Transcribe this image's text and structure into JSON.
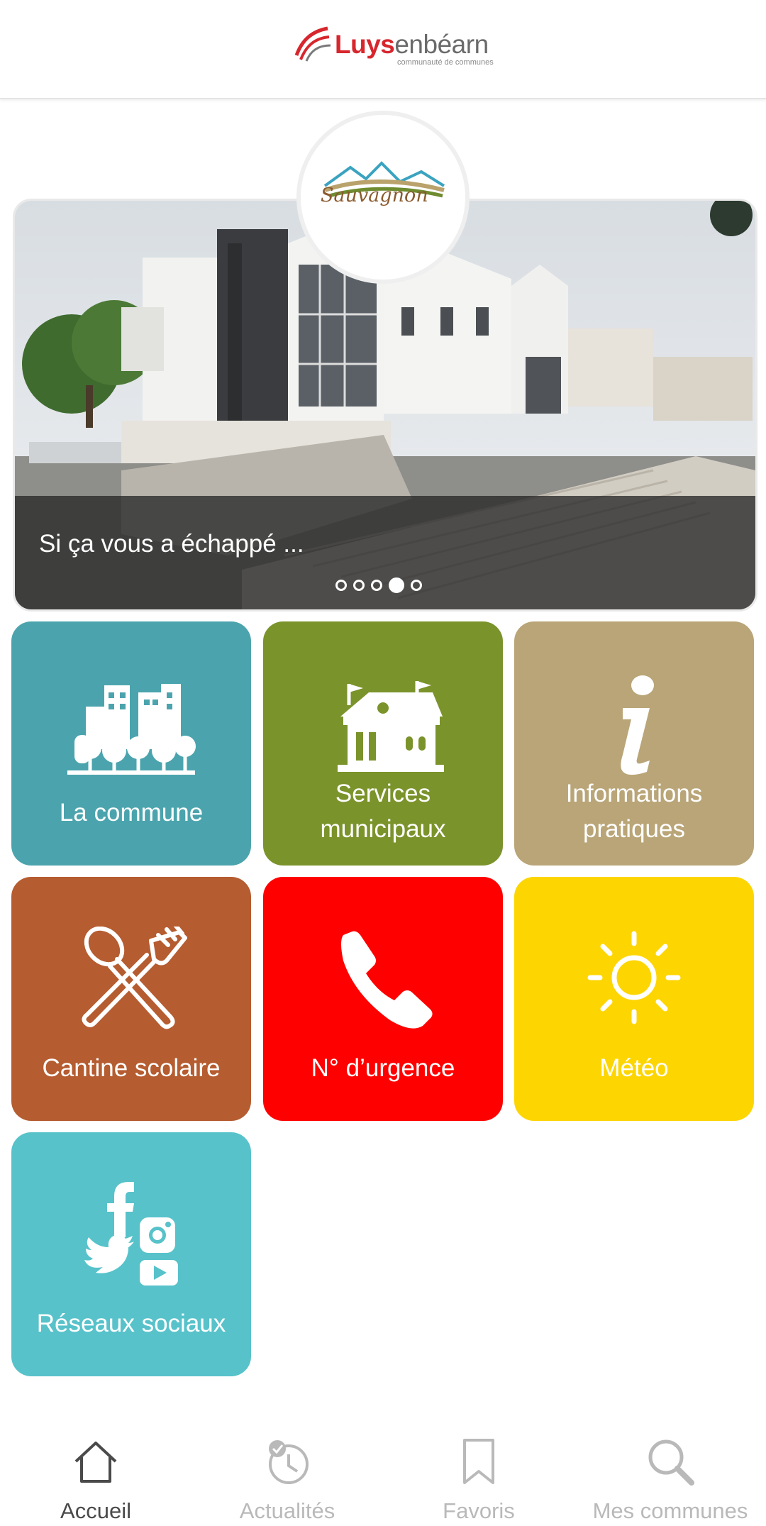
{
  "brand": {
    "name_bold": "Luys",
    "name_light": "enbéarn",
    "tagline": "communauté de communes"
  },
  "carousel": {
    "emblem_text": "Sauvagnon",
    "caption": "Si ça vous a échappé ...",
    "slide_count": 5,
    "active_slide": 4
  },
  "tiles": [
    {
      "label": "La commune",
      "color": "#4ba4ad",
      "icon": "city-icon"
    },
    {
      "label": "Services municipaux",
      "color": "#7b932b",
      "icon": "town-hall-icon"
    },
    {
      "label": "Informations pratiques",
      "color": "#b9a577",
      "icon": "info-icon"
    },
    {
      "label": "Cantine scolaire",
      "color": "#b55c30",
      "icon": "spoon-fork-icon"
    },
    {
      "label": "N° d’urgence",
      "color": "#fe0000",
      "icon": "phone-icon"
    },
    {
      "label": "Météo",
      "color": "#fdd500",
      "icon": "sun-icon"
    },
    {
      "label": "Réseaux sociaux",
      "color": "#57c2ca",
      "icon": "social-media-icon"
    }
  ],
  "nav": [
    {
      "label": "Accueil",
      "icon": "home-icon",
      "active": true
    },
    {
      "label": "Actualités",
      "icon": "news-clock-icon",
      "active": false
    },
    {
      "label": "Favoris",
      "icon": "bookmark-icon",
      "active": false
    },
    {
      "label": "Mes communes",
      "icon": "search-icon",
      "active": false
    }
  ]
}
